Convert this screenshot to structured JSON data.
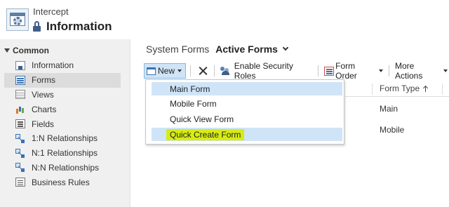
{
  "header": {
    "entity_name": "Intercept",
    "form_name": "Information"
  },
  "nav": {
    "section": "Common",
    "items": [
      {
        "label": "Information",
        "icon": "information-icon"
      },
      {
        "label": "Forms",
        "icon": "forms-icon",
        "active": true
      },
      {
        "label": "Views",
        "icon": "views-icon"
      },
      {
        "label": "Charts",
        "icon": "charts-icon"
      },
      {
        "label": "Fields",
        "icon": "fields-icon"
      },
      {
        "label": "1:N Relationships",
        "icon": "relationship-icon"
      },
      {
        "label": "N:1 Relationships",
        "icon": "relationship-icon"
      },
      {
        "label": "N:N Relationships",
        "icon": "relationship-icon"
      },
      {
        "label": "Business Rules",
        "icon": "business-rules-icon"
      }
    ]
  },
  "main": {
    "breadcrumb_label": "System Forms",
    "view_name": "Active Forms",
    "toolbar": {
      "new_label": "New",
      "security_label": "Enable Security Roles",
      "form_order_label": "Form Order",
      "more_actions_label": "More Actions"
    },
    "grid": {
      "column": "Form Type",
      "rows": [
        "Main",
        "Mobile"
      ]
    },
    "new_menu": {
      "items": [
        "Main Form",
        "Mobile Form",
        "Quick View Form",
        "Quick Create Form"
      ]
    }
  },
  "colors": {
    "highlight": "#d7ec11",
    "selection": "#cfe4f7",
    "nav_bg": "#f0f0f0"
  }
}
